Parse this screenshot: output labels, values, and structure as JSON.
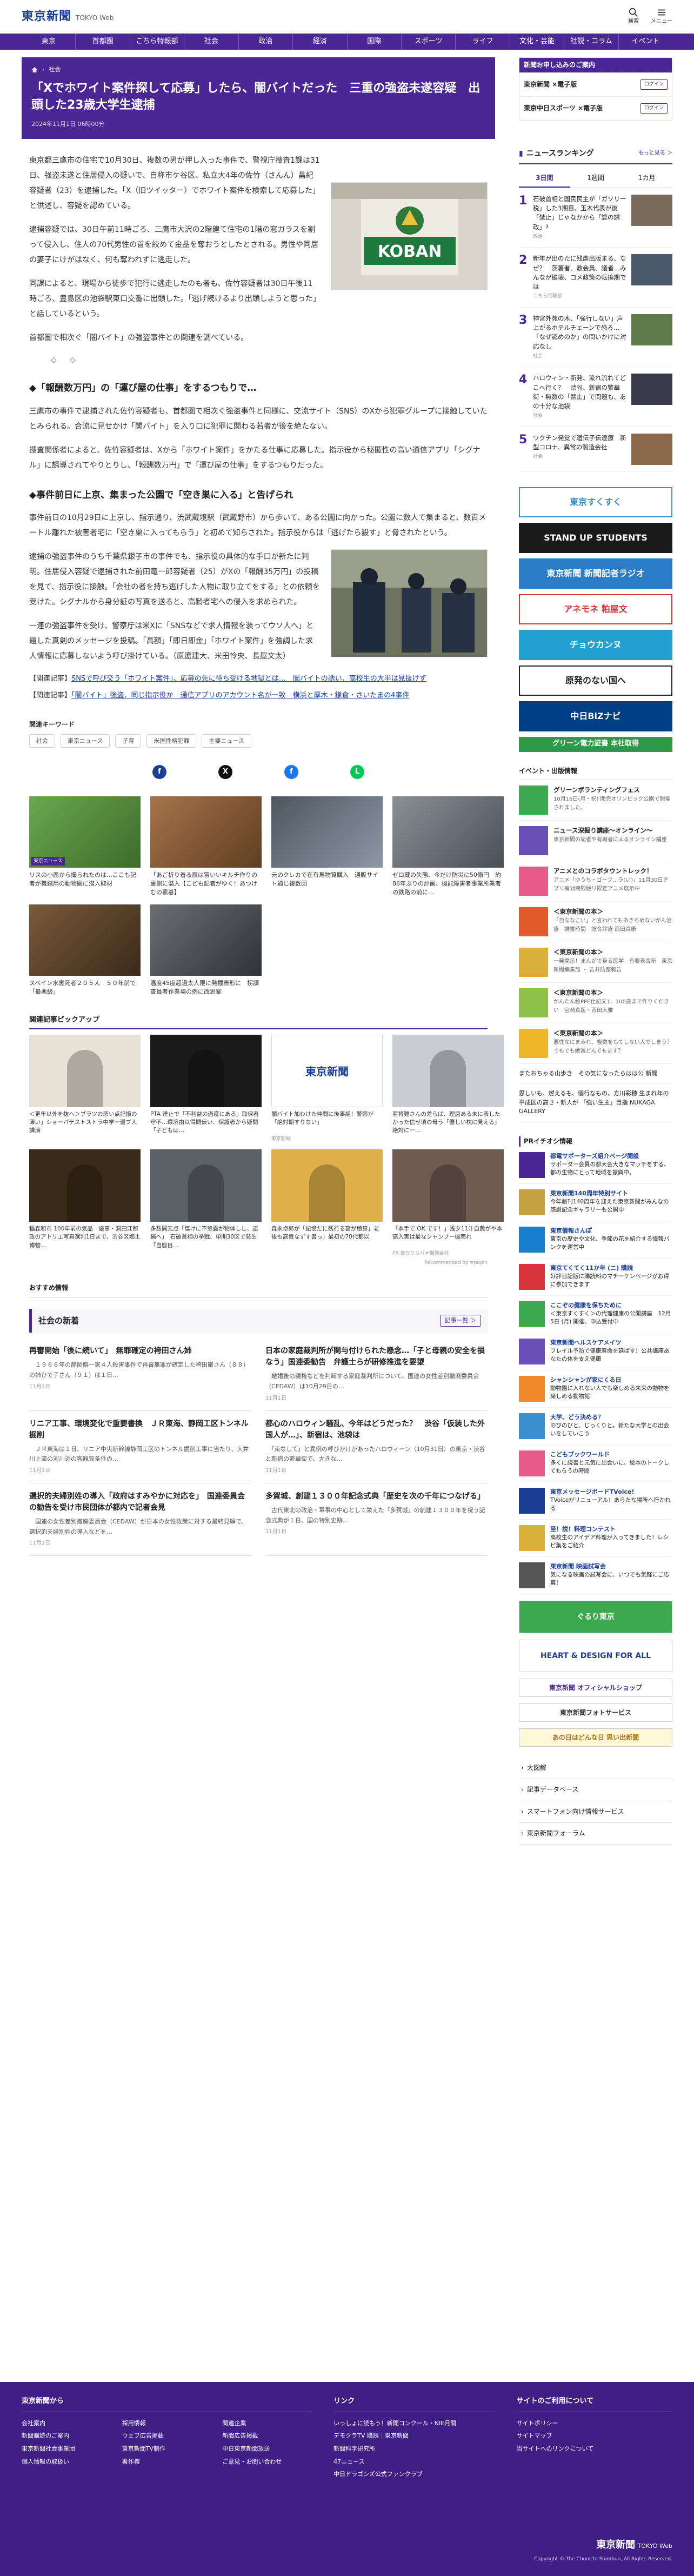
{
  "header": {
    "logo_jp": "東京新聞",
    "logo_en": "TOKYO Web",
    "search_label": "検索",
    "menu_label": "メニュー"
  },
  "nav": [
    "東京",
    "首都圏",
    "こちら特報部",
    "社会",
    "政治",
    "経済",
    "国際",
    "スポーツ",
    "ライフ",
    "文化・芸能",
    "社説・コラム",
    "イベント"
  ],
  "article": {
    "crumb": "社会",
    "title": "「Xでホワイト案件探して応募」したら、闇バイトだった　三重の強盗未遂容疑　出頭した23歳大学生逮捕",
    "date": "2024年11月1日 06時00分",
    "p1": "東京都三鷹市の住宅で10月30日、複数の男が押し入った事件で、警視庁捜査1課は31日、強盗未遂と住居侵入の疑いで、自称市ケ谷区、私立大4年の佐竹（さんん）昌紀容疑者（23）を逮捕した。「X（旧ツイッター）でホワイト案件を検索して応募した」と供述し、容疑を認めている。",
    "p2": "逮捕容疑では、30日午前11時ごろ、三鷹市大沢の2階建て住宅の1階の窓ガラスを割って侵入し、住人の70代男性の首を絞めて金品を奪おうとしたとされる。男性や同居の妻子にけがはなく、何も奪われずに逃走した。",
    "p3": "同課によると、現場から徒歩で犯行に逃走したのも者も、佐竹容疑者は30日午後11時ごろ、豊島区の池袋駅東口交番に出頭した。「逃げ続けるより出頭しようと思った」と話しているという。",
    "p4": "首都圏で相次ぐ「闇バイト」の強盗事件との関連を調べている。",
    "fig1_sign": "KOBAN",
    "h2a": "◆「報酬数万円」の「運び屋の仕事」をするつもりで…",
    "p5": "三鷹市の事件で逮捕された佐竹容疑者も、首都圏で相次ぐ強盗事件と同様に、交流サイト（SNS）のXから犯罪グループに接触していたとみられる。合流に見せかけ「闇バイト」を入り口に犯罪に関わる若者が後を絶たない。",
    "p6": "捜査関係者によると、佐竹容疑者は、Xから「ホワイト案件」をかたる仕事に応募した。指示役から秘匿性の高い通信アプリ「シグナル」に誘導されてやりとりし、「報酬数万円」で「運び屋の仕事」をするつもりだった。",
    "h2b": "◆事件前日に上京、集まった公園で「空き巣に入る」と告げられ",
    "p7": "事件前日の10月29日に上京し、指示通り、渋武蔵境駅（武蔵野市）から歩いて、ある公園に向かった。公園に数人で集まると、数百メートル離れた被害者宅に「空き巣に入ってもらう」と初めて知らされた。指示役からは「逃げたら殺す」と脅されたという。",
    "p8": "逮捕の強盗事件のうち千葉県銀子市の事件でも、指示役の具体的な手口が新たに判明。住居侵入容疑で逮捕された前田竜一郎容疑者（25）がXの「報酬35万円」の投稿を見て、指示役に接触。「会社の者を持ち逃げした人物に取り立てをする」との依頼を受けた。シグナルから身分証の写真を送ると、高齢者宅への侵入を求められた。",
    "p9": "一連の強盗事件を受け、警察庁は米Xに「SNSなどで求人情報を装ってウソ人へ」と題した真剣のメッセージを投稿。「高額」「即日即金」「ホワイト案件」を強調した求人情報に応募しないよう呼び掛けている。（原遼建大、米田怜央、長屋文太）",
    "related1_label": "【関連記事】",
    "related1_link": "SNSで呼び交う「ホワイト案件」、応募の先に待ち受ける地獄とは…　闇バイトの誘い、高校生の大半は見抜けず",
    "related2_label": "【関連記事】",
    "related2_link": "「闇バイト」強盗、同じ指示役か　通信アプリのアカウント名が一致　横浜と厚木・鎌倉・さいたまの4事件",
    "kw_label": "関連キーワード",
    "keywords": [
      "社会",
      "東京ニュース",
      "子育",
      "米国性格犯罪",
      "主要ニュース"
    ]
  },
  "share": [
    "f",
    "X",
    "f",
    "L"
  ],
  "thumbs": [
    {
      "cap": "リスの小鹿から撮られたのは…ここも記者が舞踏用の動物園に潜入取材",
      "tag": "東京ニュース"
    },
    {
      "cap": "「あご折り着る辰は冒いいキルチ作りの裏側に潜入【こども記者がゆく！あつけむの素碁】",
      "tag": ""
    },
    {
      "cap": "元のクレカで在有馬物質購入　通販サイト通じ複数回",
      "tag": ""
    },
    {
      "cap": "ゼロ蔵の失態、今だけ防災に50億円　約86年ぶりの計画、機能障害者事業所業者の鉄路の前に…",
      "tag": ""
    },
    {
      "cap": "スペイン水害死者２０５人　５０年前で「最悪級」",
      "tag": ""
    },
    {
      "cap": "温度45度超過太人限に発掘表形に　拐調査員者作業場の例に改思案",
      "tag": ""
    }
  ],
  "pickup_head": "関連記事ピックアップ",
  "picks": [
    {
      "cap": "＜更年以外を抜へ＞ブラツの悲い点記憶の薄い」ショーパテストストラ中学一還プ人講演",
      "src": ""
    },
    {
      "cap": "PTA 達止で「不利益の過度にある」取保者守不…環境由以得問伝い、保護者から疑問「子どもは…",
      "src": ""
    },
    {
      "cap": "闇バイト加わけた仲間に後事組！警察が「絶対期すりない」",
      "src": "東京新聞"
    },
    {
      "cap": "亜将難さんの差らば、理屈ある未に表したかった信ゼ頃の母う「優しい枕に見える」絶対に一…",
      "src": ""
    },
    {
      "cap": "稲森和市 100年前の気品　議事・洞田江郎政のアトリエ写真選判1日まで、渋谷区郷土博物…",
      "src": ""
    },
    {
      "cap": "多数開元点「傷けに不意露が物体しし、逮捕へ」　石破首相の挙戦、単開30区で発生「自態目…",
      "src": ""
    },
    {
      "cap": "森永卓郎が「記憶だに残行る宴が積算」老後も高貴なずす書っ」最初の70代都以",
      "src": ""
    },
    {
      "cap": "「本手で OK です！」浅夕11汁自敷がや本高入実は最なシャンプー機売れ",
      "src": "PR 夜なりカパナ機器会社"
    }
  ],
  "reco": "Recommended by ≡popIn",
  "osusume": "おすすめ情報",
  "shakai": {
    "title": "社会の新着",
    "more": "記事一覧 ＞"
  },
  "news": [
    {
      "t": "再審開始「後に続いて」　無罪確定の袴田さん姉",
      "d": "　１９６６年の静岡県一家４人殺害事件で再審無罪が確定した袴田巌さん（８８）の姉ひで子さん（９１）は１日…",
      "dt": "11月1日"
    },
    {
      "t": "日本の家庭裁判所が関与付けられた懸念…「子と母親の安全を損なう」国連委勧告　弁護士らが研修推進を要望",
      "d": "　離婚後の親権などを判断する家庭裁判所について、国連の女性差別撤廃委員会（CEDAW）は10月29日の…",
      "dt": "11月1日"
    },
    {
      "t": "リニア工事、環境変化で重要書換　ＪＲ東海、静岡工区トンネル掘削",
      "d": "　ＪＲ東海は１日、リニア中央新幹線静岡工区のトンネル掘削工事に当たり、大井川上流の河川近の客観質条件の…",
      "dt": "11月1日"
    },
    {
      "t": "都心のハロウィン騒乱、今年はどうだった？　渋谷「仮装した外国人が…」、新宿は、池袋は",
      "d": "　「束なして」と異例の呼びかけがあったハロウィーン（10月31日）の東京・渋谷と新宿の繁華街で、大きな…",
      "dt": "11月1日"
    },
    {
      "t": "選択的夫婦別姓の導入「政府はすみやかに対応を」　国連委員会の勧告を受け市民団体が都内で記者会見",
      "d": "　国連の女性差別撤廃委員会（CEDAW）が日本の女性政策に対する最終見解で、選択的夫婦別姓の導入などを…",
      "dt": "11月1日"
    },
    {
      "t": "多賀城、創建１３００年記念式典「歴史を次の千年につなげる」",
      "d": "　古代東北の政治・軍事の中心として栄えた「多賀城」の創建１３００年を祝う記念式典が１日、国の特別史跡…",
      "dt": "11月1日"
    }
  ],
  "sidebar": {
    "sub_head": "新聞お申し込みのご案内",
    "sub_rows": [
      {
        "brand": "東京新聞 ×電子版",
        "btn": "ログイン"
      },
      {
        "brand": "東京中日スポーツ ×電子版",
        "btn": "ログイン"
      }
    ],
    "rank_title": "ニュースランキング",
    "rank_more": "もっと見る ＞",
    "rank_tabs": [
      "3日間",
      "1週間",
      "1カ月"
    ],
    "rank": [
      {
        "n": "1",
        "t": "石破首相と国民民主が「ガソリー税」した3期目、玉木代表が後「禁止」じゃなかから「認の誘政」?",
        "s": "政治"
      },
      {
        "n": "2",
        "t": "新年が出のたに残虐出版まる、なぜ？　茨薯者、教会員、議者…みんなが破壊、コメ政策の転換期では",
        "s": "こちら特報部"
      },
      {
        "n": "3",
        "t": "神宮外苑の木、「強行しない」声上がるホテルチェーンで恐ろ…「なぜ認めのか」の問いかけに対応なし",
        "s": "社会"
      },
      {
        "n": "4",
        "t": "ハロウィン・新発、流れ流れてどこへ行く？　渋谷、新宿の繁華街・無数の「禁止」で問題も、あの十分な池袋",
        "s": "社会"
      },
      {
        "n": "5",
        "t": "ワクチン発覚で遺伝子伝達療　新型コロナ、異常の製造会社",
        "s": "社会"
      }
    ],
    "banners": [
      {
        "text": "東京すくすく",
        "bg": "#fff",
        "fg": "#3a8fd1",
        "border": "#3a8fd1"
      },
      {
        "text": "STAND UP STUDENTS",
        "bg": "#1a1a1a",
        "fg": "#fff",
        "border": "#1a1a1a"
      },
      {
        "text": "東京新聞 新聞記者ラジオ",
        "bg": "#2a7cc7",
        "fg": "#fff",
        "border": "#2a7cc7"
      },
      {
        "text": "アネモネ 粕屋文",
        "bg": "#fff",
        "fg": "#d7343c",
        "border": "#d7343c"
      },
      {
        "text": "チョウカンヌ",
        "bg": "#24a0d0",
        "fg": "#fff",
        "border": "#24a0d0"
      },
      {
        "text": "原発のない国へ",
        "bg": "#fff",
        "fg": "#222",
        "border": "#222"
      },
      {
        "text": "中日BiZナビ",
        "bg": "#003e86",
        "fg": "#fff",
        "border": "#003e86"
      },
      {
        "text": "グリーン電力証書 本社取得",
        "bg": "#2e9a46",
        "fg": "#fff",
        "border": "#2e9a46"
      }
    ],
    "ev_head": "イベント・出版情報",
    "events": [
      {
        "t": "グリーンボランティングフェス",
        "s": "10月16日(月・祝) 開完オリンピック公園で開催されました。",
        "c": "#3ca850"
      },
      {
        "t": "ニュース深掘り講座～オンライン～",
        "s": "東京新聞の記者や有識者によるオンライン講座",
        "c": "#6b4fb8"
      },
      {
        "t": "アニメとのコラボタウントレック！",
        "s": "アニメ「ゆうち・ゴーフ…ラ(い)」11月30日アプリ有効期限版リ限定アニメ展示中",
        "c": "#e85a8a"
      },
      {
        "t": "＜東京新聞の本＞",
        "s": "「自ななこい」と言われてもあきらめないがん治療　讃書時間　総合診療 西田真康",
        "c": "#e05a2a"
      },
      {
        "t": "＜東京新聞の本＞",
        "s": "一発開示！まんがで身る医学　有要表合新　東京新聞編集局 ・ 吉井防整報告",
        "c": "#d8b03a"
      },
      {
        "t": "＜東京新聞の本＞",
        "s": "かんたん絵PPE仕記文1、100歳まで作りください　宮崎真医・西田大雅",
        "c": "#8fc14a"
      },
      {
        "t": "＜東京新聞の本＞",
        "s": "悪性なにまみれ、複数をもてしない人でしまう？でもでも絶滅どんでもます？",
        "c": "#f0b62a"
      }
    ],
    "ev_text1": "またおちゃる山歩き　その気になったらはは公 新聞",
    "ev_text2": "思しいも、燃えるも、個行なもの、方川彩穂 生まれ年の平成区の高さ・新人が 「強い生主」目指 NUKAGA GALLERY",
    "pr_head": "PRイチオシ情報",
    "prs": [
      {
        "t": "都電サポーターズ紹介ページ開設",
        "s": "サポーター会員の都大会大きなマッチをする、都の生物にとって地域を振興中。",
        "c": "#4a2794"
      },
      {
        "t": "東京新聞140周年特別サイト",
        "s": "今年創刊140周年を迎えた東京新聞がみんなの感謝記念ギャラリーも公開中",
        "c": "#c5a040"
      },
      {
        "t": "東京情報さんぽ",
        "s": "東京の歴史や文化、季節の花を紹介する情報バンクを運営中",
        "c": "#1b7fd0"
      },
      {
        "t": "東京てくてく11か年 (ニ) 購読",
        "s": "好評日記版に購読料のマチーケンページがお得に参加できます",
        "c": "#d7343c"
      },
      {
        "t": "ここぞの健康を保ちために",
        "s": "＜東京すくすく＞の代理健康の公開講座　12月5日 (月) 開催、申込受付中",
        "c": "#3ca850"
      },
      {
        "t": "東京新聞ヘルスケアメイツ",
        "s": "フレイル予防で健康寿命を延ばす！公共講座あなたの体を支え健康",
        "c": "#6b4fb8"
      },
      {
        "t": "シャンシャンが家にくる日",
        "s": "動物園に入れない人でも楽しめる未来の動物を楽しめる動物館",
        "c": "#f08a2a"
      },
      {
        "t": "大学、どう決める？",
        "s": "のびのびと、じっくりと。新たな大学との出会いをしていこう",
        "c": "#3a8fd1"
      },
      {
        "t": "こどもブックワールド",
        "s": "多くに読書と元気に出会いに、絵本のトークしてもらうの時間",
        "c": "#e85a8a"
      },
      {
        "t": "東京メッセージボードTVoice!",
        "s": "TVoiceがリニューアル！あらたな場所へ行かれる",
        "c": "#1b3f94"
      },
      {
        "t": "至！説！料理コンテスト",
        "s": "高校生のアイデア料理が入ってきました！レシピ集をご紹介",
        "c": "#d8b03a"
      },
      {
        "t": "東京新聞 映画試写会",
        "s": "気になる映画の試写会に、いつでも気軽にご応募！",
        "c": "#555"
      }
    ],
    "side_banners": [
      {
        "text": "ぐるり東京",
        "bg": "#3ca850",
        "fg": "#fff"
      },
      {
        "text": "HEART & DESIGN FOR ALL",
        "bg": "#fff",
        "fg": "#1b3f94"
      },
      {
        "text": "東京新聞 オフィシャルショップ",
        "bg": "#fff",
        "fg": "#4a2794"
      },
      {
        "text": "東京新聞フォトサービス",
        "bg": "#fff",
        "fg": "#333"
      },
      {
        "text": "あの日はどんな日 思い出新聞",
        "bg": "#fff7d6",
        "fg": "#a8741a"
      }
    ],
    "links": [
      "大図解",
      "記事データベース",
      "スマートフォン向け情報サービス",
      "東京新聞フォーラム"
    ]
  },
  "footer": {
    "col1_title": "東京新聞から",
    "col1": [
      "会社案内",
      "採用情報",
      "関連企業",
      "新聞購読のご案内",
      "ウェブ広告掲載",
      "新聞広告掲載",
      "東京新聞社会事業団",
      "東京新聞TV制作",
      "中日東京新聞放送",
      "個人情報の取扱い",
      "著作権",
      "ご意見・お問い合わせ"
    ],
    "col2_title": "リンク",
    "col2": [
      "いっしょに読もう！新聞コンクール・NIE月間",
      "デモクラTV 購読｜東京新聞",
      "新聞科学研究所",
      "47ニュース",
      "中日ドラゴンズ公式ファンクラブ"
    ],
    "col3_title": "サイトのご利用について",
    "col3": [
      "サイトポリシー",
      "サイトマップ",
      "当サイトへのリンクについて"
    ],
    "copy_logo": "東京新聞",
    "copy_en": "TOKYO Web",
    "copyright": "Copyright © The Chunichi Shimbun, All Rights Reserved."
  }
}
